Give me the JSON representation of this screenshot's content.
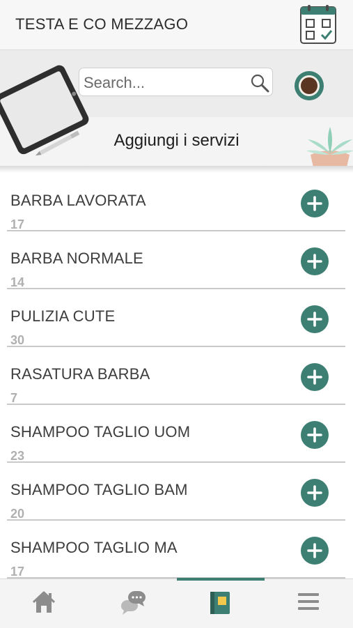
{
  "header": {
    "title": "TESTA E CO MEZZAGO",
    "calendar_icon": "calendar-check-icon"
  },
  "search": {
    "placeholder": "Search...",
    "value": "",
    "icon": "search-icon"
  },
  "banner": {
    "title": "Aggiungi i servizi",
    "avatar_icon": "coffee-cup-icon"
  },
  "services": [
    {
      "name": "BARBA LAVORATA",
      "duration": "17"
    },
    {
      "name": "BARBA NORMALE",
      "duration": "14"
    },
    {
      "name": "PULIZIA CUTE",
      "duration": "30"
    },
    {
      "name": "RASATURA BARBA",
      "duration": "7"
    },
    {
      "name": "SHAMPOO TAGLIO UOM",
      "duration": "23"
    },
    {
      "name": "SHAMPOO TAGLIO BAM",
      "duration": "20"
    },
    {
      "name": "SHAMPOO TAGLIO MA",
      "duration": "17"
    }
  ],
  "tabbar": {
    "tabs": [
      {
        "icon": "home-icon",
        "active": false
      },
      {
        "icon": "chat-bubbles-icon",
        "active": false
      },
      {
        "icon": "notebook-icon",
        "active": true
      },
      {
        "icon": "menu-icon",
        "active": false
      }
    ],
    "accent_color": "#3d7f72"
  },
  "colors": {
    "accent": "#3d7f72",
    "background": "#ffffff",
    "banner_bg": "#ececec"
  }
}
